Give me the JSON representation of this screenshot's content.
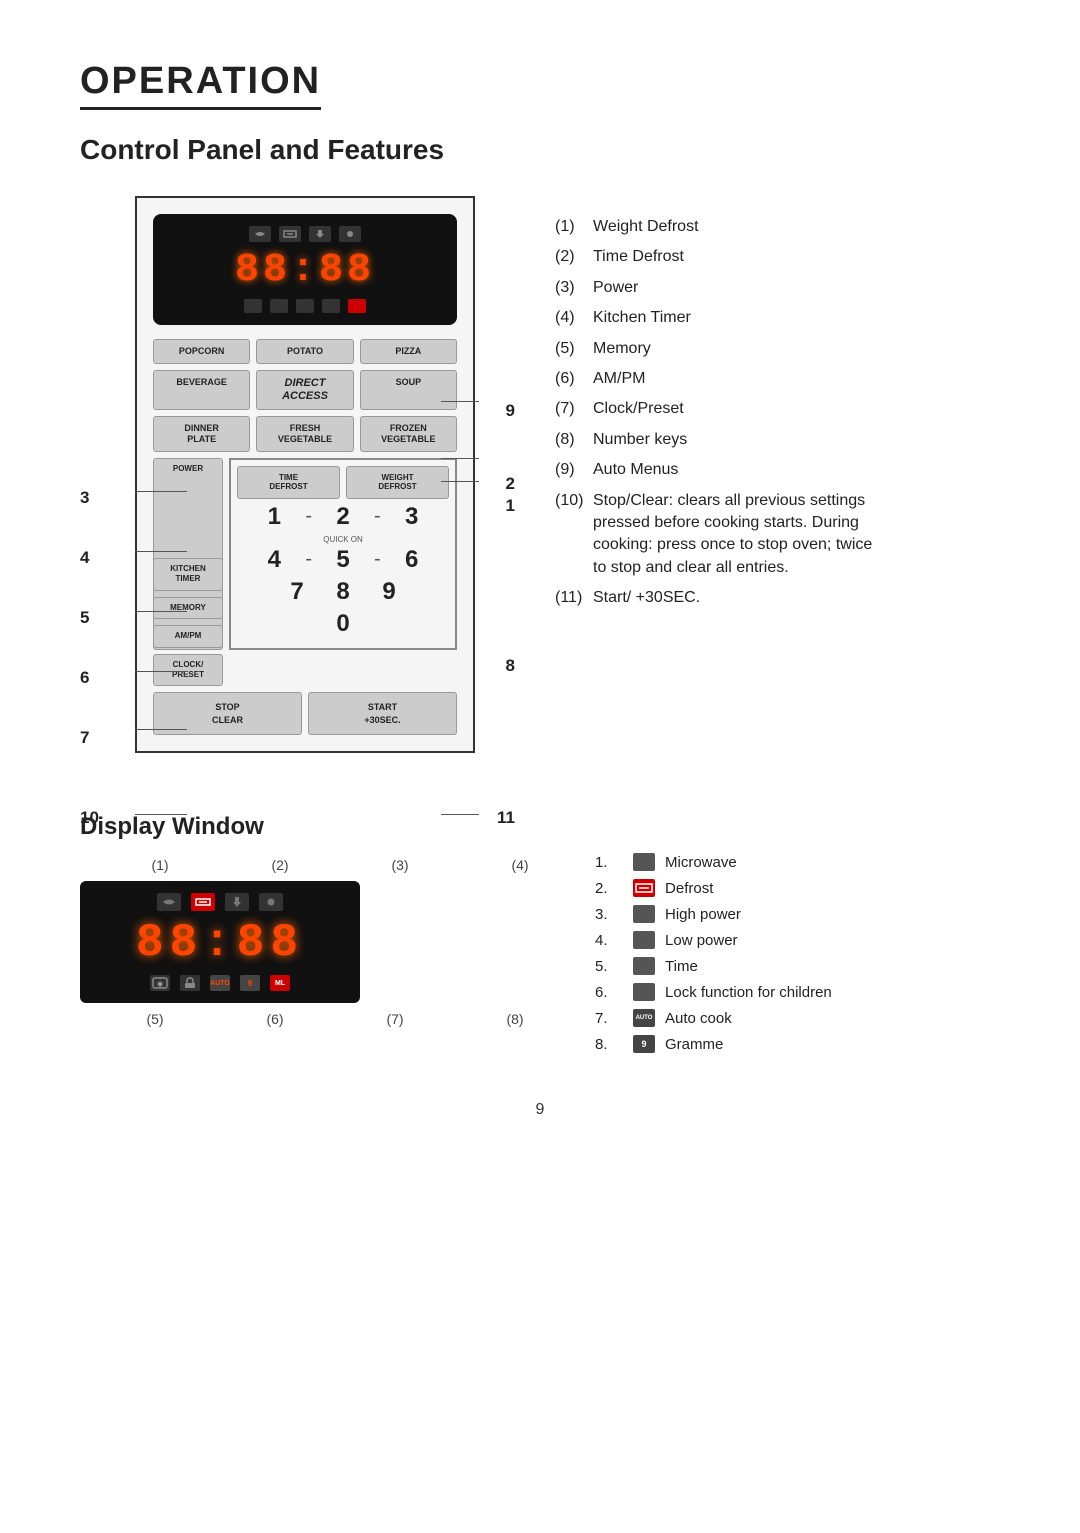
{
  "page": {
    "title": "OPERATION",
    "subtitle": "Control Panel and Features"
  },
  "features": {
    "items": [
      {
        "num": "(1)",
        "text": "Weight Defrost"
      },
      {
        "num": "(2)",
        "text": "Time Defrost"
      },
      {
        "num": "(3)",
        "text": "Power"
      },
      {
        "num": "(4)",
        "text": "Kitchen Timer"
      },
      {
        "num": "(5)",
        "text": "Memory"
      },
      {
        "num": "(6)",
        "text": "AM/PM"
      },
      {
        "num": "(7)",
        "text": "Clock/Preset"
      },
      {
        "num": "(8)",
        "text": "Number keys"
      },
      {
        "num": "(9)",
        "text": "Auto Menus"
      }
    ],
    "item10_num": "(10)",
    "item10_label": "Stop/Clear: clears all previous settings",
    "item10_note1": "pressed before cooking starts. During",
    "item10_note2": "cooking: press once to stop oven; twice",
    "item10_note3": "to stop and clear all entries.",
    "item11_num": "(11)",
    "item11_label": "Start/ +30SEC."
  },
  "panel": {
    "display_time": "88:88",
    "buttons": {
      "popcorn": "POPCORN",
      "potato": "POTATO",
      "pizza": "PIZZA",
      "beverage": "BEVERAGE",
      "direct_access": "Direct\nAccess",
      "soup": "SOUP",
      "dinner_plate": "DINNER\nPLATE",
      "fresh_vegetable": "FRESH\nVEGETABLE",
      "frozen_vegetable": "FROZEN\nVEGETABLE",
      "power": "POWER",
      "time_defrost": "TIME\nDEFROST",
      "weight_defrost": "WEIGHT\nDEFROST",
      "kitchen_timer": "KITCHEN\nTIMER",
      "memory": "MEMORY",
      "ampm": "AM/PM",
      "clock_preset": "CLOCK/\nPRESET",
      "quick_on": "QUICK ON",
      "stop_clear": "STOP\nCLEAR",
      "start": "START\n+30sec.",
      "zero": "0",
      "num1": "1",
      "num2": "2",
      "num3": "3",
      "num4": "4",
      "num5": "5",
      "num6": "6",
      "num7": "7",
      "num8": "8",
      "num9": "9"
    },
    "annotations": {
      "label_1": "1",
      "label_2": "2",
      "label_3": "3",
      "label_4": "4",
      "label_5": "5",
      "label_6": "6",
      "label_7": "7",
      "label_8": "8",
      "label_9": "9",
      "label_10": "10",
      "label_11": "11"
    }
  },
  "display_window": {
    "title": "Display  Window",
    "callouts_top": [
      "(1)",
      "(2)",
      "(3)",
      "(4)"
    ],
    "callouts_bottom": [
      "(5)",
      "(6)",
      "(7)",
      "(8)"
    ],
    "display_time": "88:88",
    "features": [
      {
        "num": "1.",
        "icon": "microwave-icon",
        "text": "Microwave"
      },
      {
        "num": "2.",
        "icon": "defrost-icon",
        "text": "Defrost"
      },
      {
        "num": "3.",
        "icon": "highpower-icon",
        "text": "High power"
      },
      {
        "num": "4.",
        "icon": "lowpower-icon",
        "text": "Low power"
      },
      {
        "num": "5.",
        "icon": "time-icon",
        "text": "Time"
      },
      {
        "num": "6.",
        "icon": "lock-icon",
        "text": "Lock function for children"
      },
      {
        "num": "7.",
        "icon": "autocook-icon",
        "text": "Auto cook"
      },
      {
        "num": "8.",
        "icon": "gramme-icon",
        "text": "Gramme"
      }
    ]
  },
  "page_number": "9"
}
